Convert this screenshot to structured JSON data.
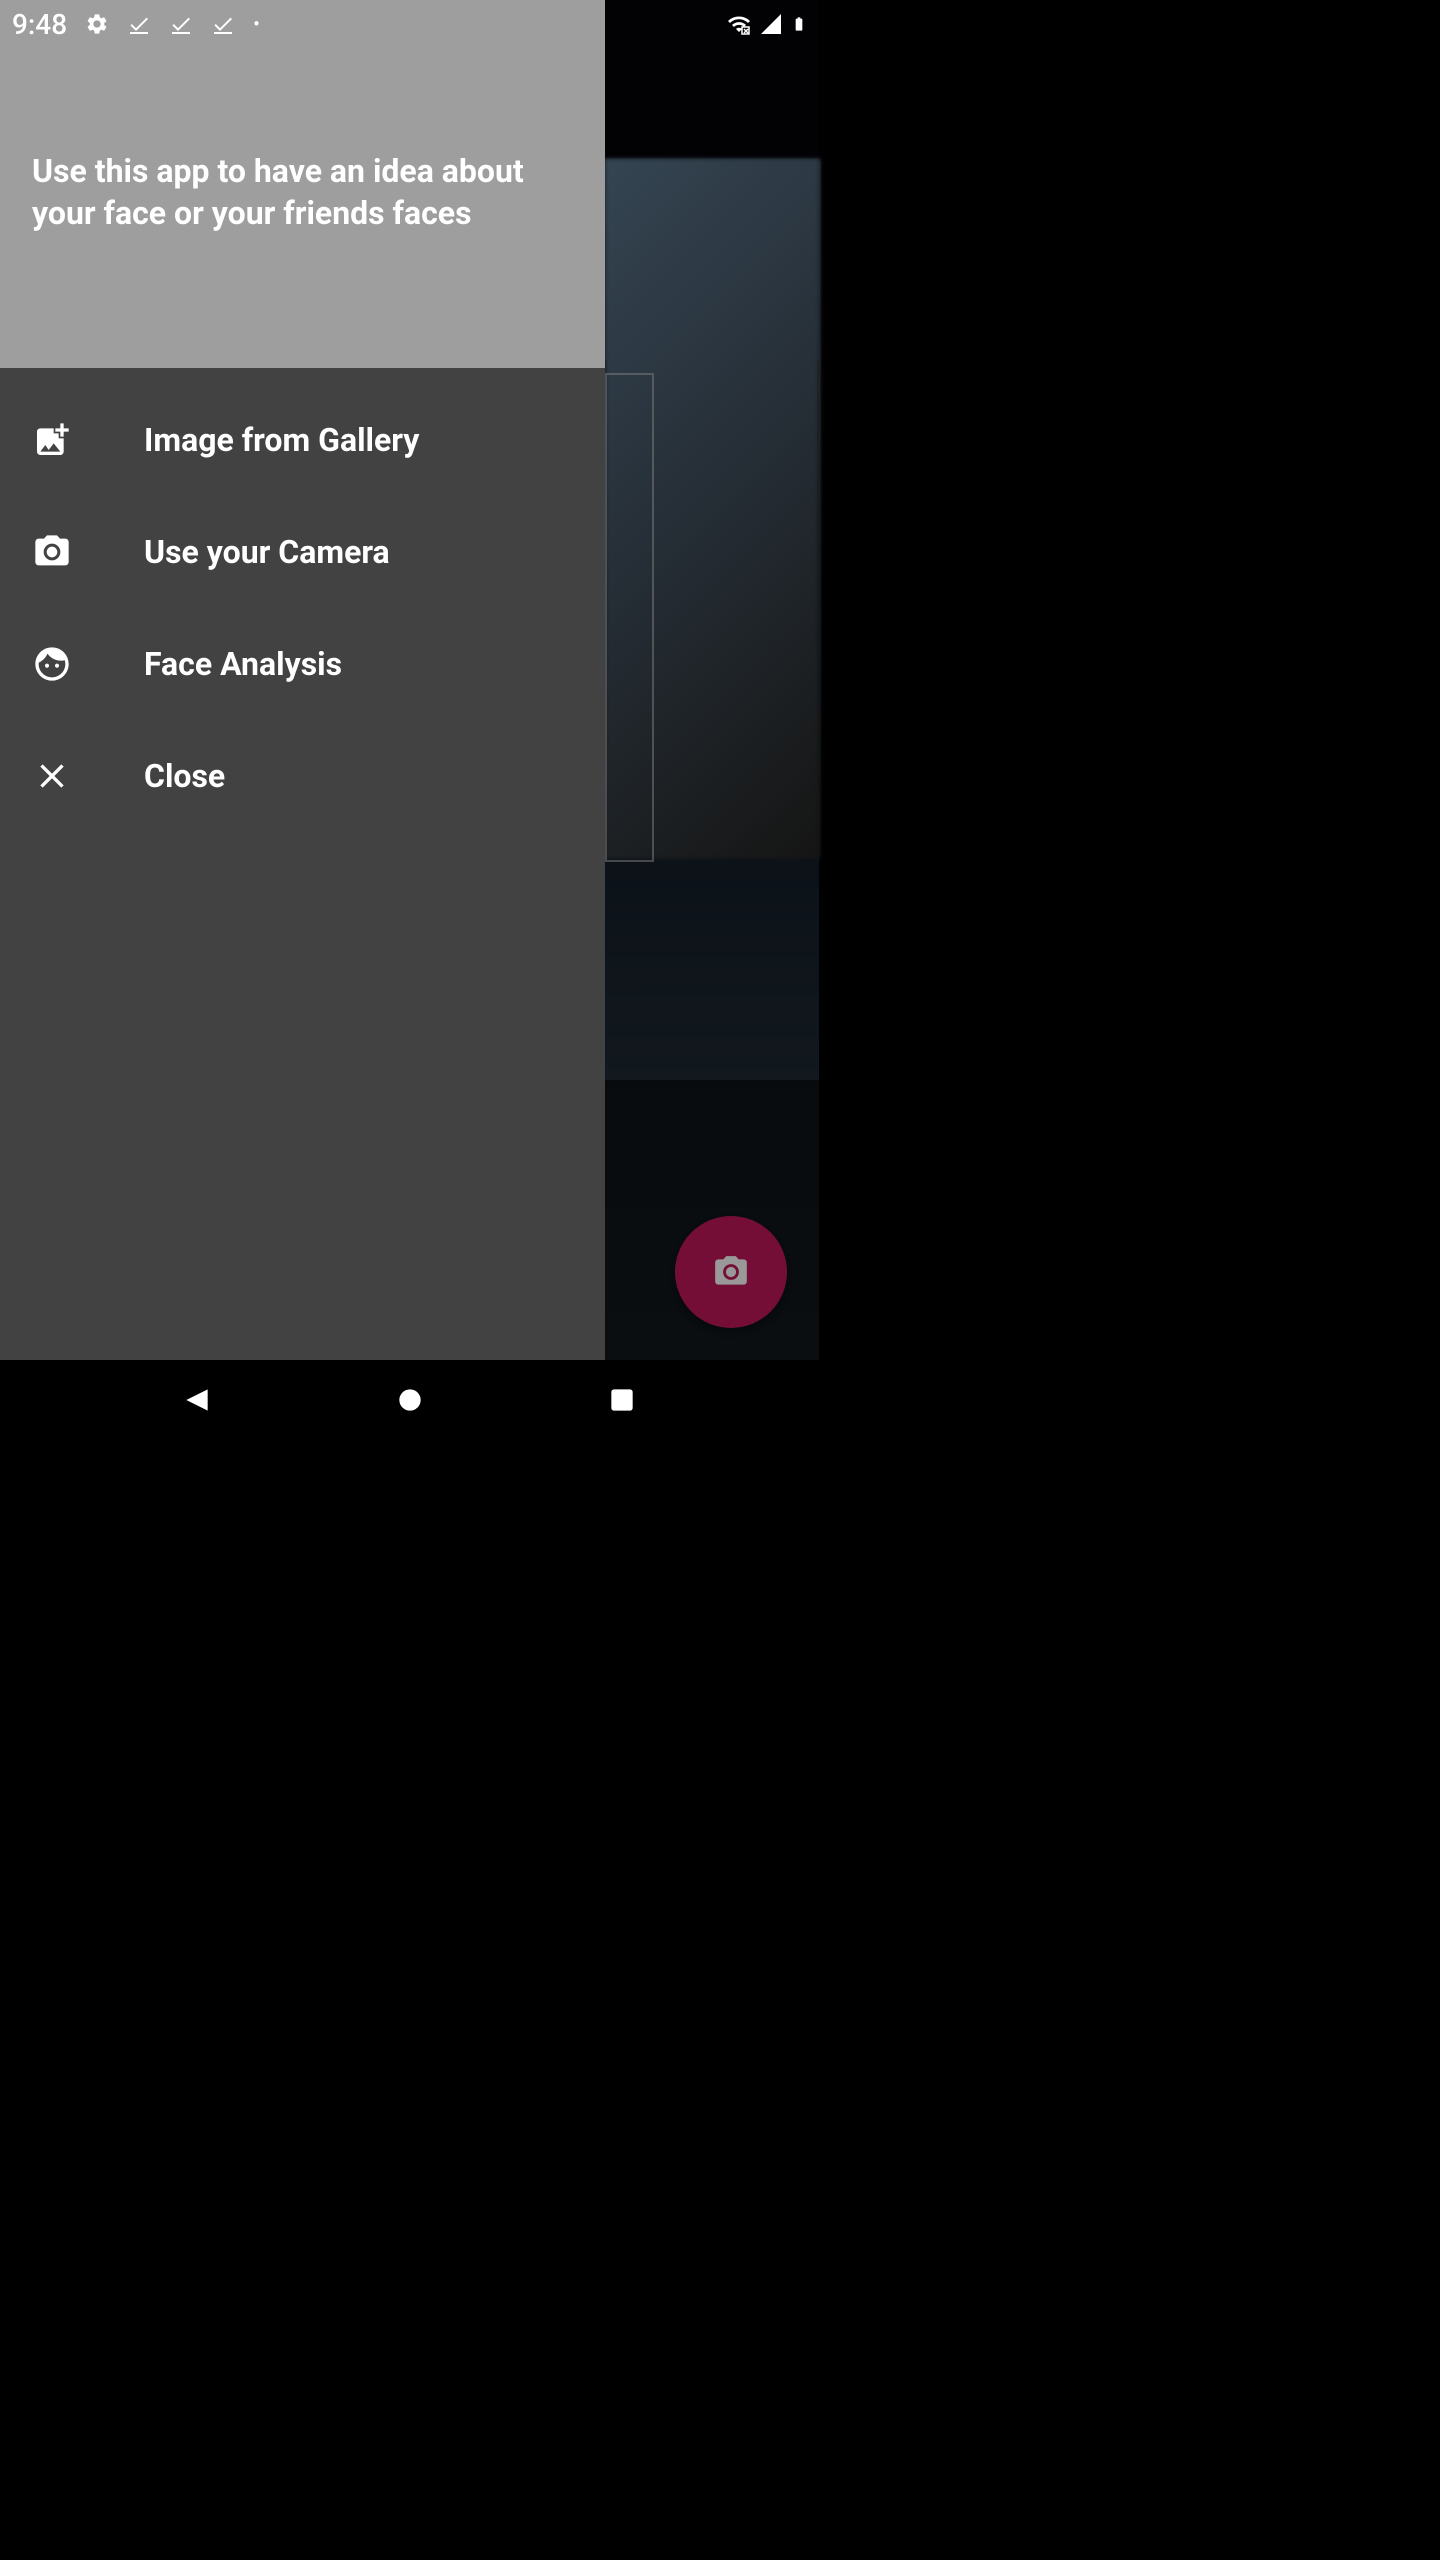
{
  "status_bar": {
    "time": "9:48"
  },
  "drawer": {
    "header_text": "Use this app to have an idea about your face or your friends faces",
    "menu_items": [
      {
        "icon": "gallery",
        "label": "Image from Gallery"
      },
      {
        "icon": "camera",
        "label": "Use your Camera"
      },
      {
        "icon": "face",
        "label": "Face Analysis"
      },
      {
        "icon": "close",
        "label": "Close"
      }
    ]
  },
  "colors": {
    "drawer_bg": "#424242",
    "drawer_header_bg": "#9E9E9E",
    "fab_bg": "#c2185b"
  }
}
